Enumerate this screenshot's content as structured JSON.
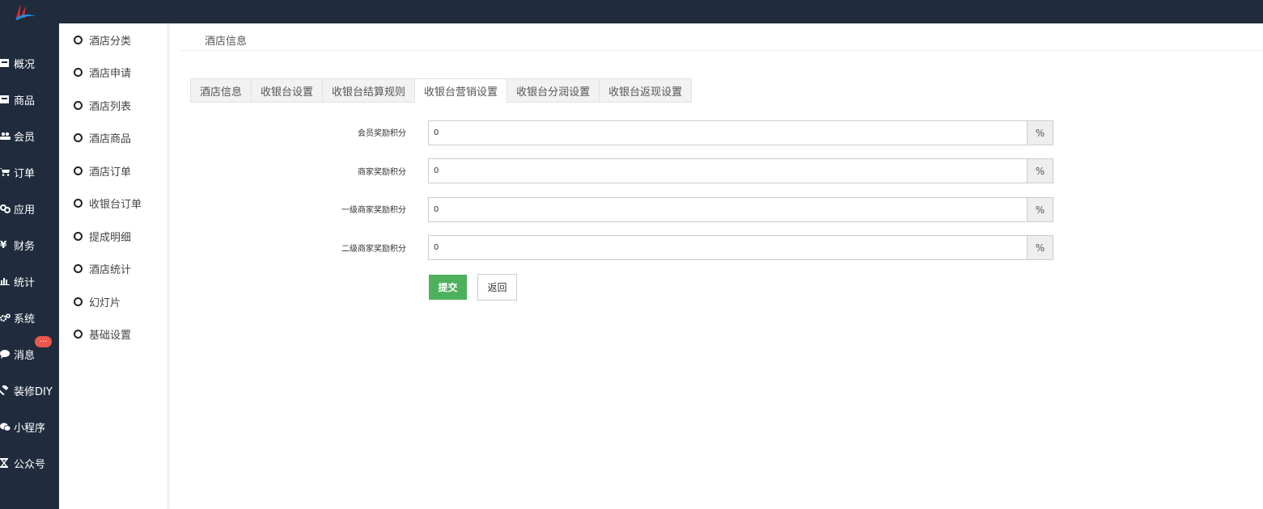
{
  "nav": {
    "items": [
      {
        "label": "概况",
        "icon": "dashboard-icon"
      },
      {
        "label": "商品",
        "icon": "goods-icon"
      },
      {
        "label": "会员",
        "icon": "users-icon"
      },
      {
        "label": "订单",
        "icon": "cart-icon"
      },
      {
        "label": "应用",
        "icon": "apps-icon"
      },
      {
        "label": "财务",
        "icon": "yen-icon"
      },
      {
        "label": "统计",
        "icon": "bar-chart-icon"
      },
      {
        "label": "系统",
        "icon": "gears-icon"
      },
      {
        "label": "消息",
        "icon": "chat-icon"
      },
      {
        "label": "装修DIY",
        "icon": "hammer-icon"
      },
      {
        "label": "小程序",
        "icon": "wechat-icon"
      },
      {
        "label": "公众号",
        "icon": "hourglass-icon"
      }
    ],
    "message_badge": "..."
  },
  "subnav": {
    "items": [
      {
        "label": "酒店分类"
      },
      {
        "label": "酒店申请"
      },
      {
        "label": "酒店列表"
      },
      {
        "label": "酒店商品"
      },
      {
        "label": "酒店订单"
      },
      {
        "label": "收银台订单"
      },
      {
        "label": "提成明细"
      },
      {
        "label": "酒店统计"
      },
      {
        "label": "幻灯片"
      },
      {
        "label": "基础设置"
      }
    ]
  },
  "breadcrumb": "酒店信息",
  "tabs": [
    {
      "label": "酒店信息",
      "active": false
    },
    {
      "label": "收银台设置",
      "active": false
    },
    {
      "label": "收银台结算规则",
      "active": false
    },
    {
      "label": "收银台营销设置",
      "active": true
    },
    {
      "label": "收银台分润设置",
      "active": false
    },
    {
      "label": "收银台返现设置",
      "active": false
    }
  ],
  "form": {
    "fields": [
      {
        "label": "会员奖励积分",
        "value": "0",
        "unit": "%"
      },
      {
        "label": "商家奖励积分",
        "value": "0",
        "unit": "%"
      },
      {
        "label": "一级商家奖励积分",
        "value": "0",
        "unit": "%"
      },
      {
        "label": "二级商家奖励积分",
        "value": "0",
        "unit": "%"
      }
    ],
    "submit_label": "提交",
    "back_label": "返回"
  },
  "colors": {
    "sidebar_bg": "#202c3d",
    "submit_bg": "#4cb05d",
    "badge_bg": "#e9574d"
  }
}
